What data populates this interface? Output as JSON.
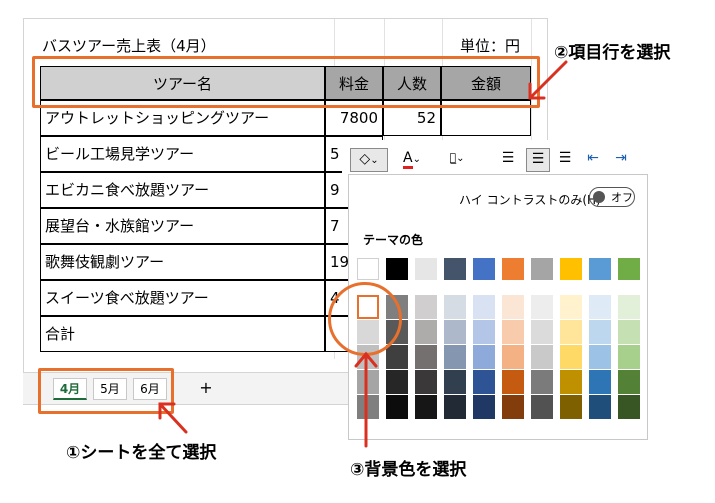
{
  "sheet": {
    "title": "バスツアー売上表（4月）",
    "unit": "単位：円",
    "headers": [
      "ツアー名",
      "料金",
      "人数",
      "金額"
    ],
    "rows": [
      {
        "name": "アウトレットショッピングツアー",
        "price": "7800",
        "people": "52"
      },
      {
        "name": "ビール工場見学ツアー",
        "price": "5",
        "people": ""
      },
      {
        "name": "エビカニ食べ放題ツアー",
        "price": "9",
        "people": ""
      },
      {
        "name": "展望台・水族館ツアー",
        "price": "7",
        "people": ""
      },
      {
        "name": "歌舞伎観劇ツアー",
        "price": "19",
        "people": ""
      },
      {
        "name": "スイーツ食べ放題ツアー",
        "price": "4",
        "people": ""
      },
      {
        "name": "合計",
        "price": "",
        "people": ""
      }
    ]
  },
  "tabs": [
    "4月",
    "5月",
    "6月"
  ],
  "add_sheet": "+",
  "palette": {
    "contrast_label": "ハイ コントラストのみ(H)",
    "toggle_label": "オフ",
    "theme_label": "テーマの色",
    "top_row": [
      "#ffffff",
      "#000000",
      "#e7e6e6",
      "#44546a",
      "#4472c4",
      "#ed7d31",
      "#a5a5a5",
      "#ffc000",
      "#5b9bd5",
      "#70ad47"
    ],
    "shades": [
      [
        "#f2f2f2",
        "#7f7f7f",
        "#d0cece",
        "#d6dce4",
        "#d9e2f3",
        "#fbe5d5",
        "#ededed",
        "#fff2cc",
        "#deebf6",
        "#e2efd9"
      ],
      [
        "#d8d8d8",
        "#595959",
        "#aeabab",
        "#adb9ca",
        "#b4c6e7",
        "#f7cbac",
        "#dbdbdb",
        "#fee599",
        "#bdd7ee",
        "#c5e0b3"
      ],
      [
        "#bfbfbf",
        "#3f3f3f",
        "#757070",
        "#8496b0",
        "#8eaadb",
        "#f4b183",
        "#c9c9c9",
        "#ffd966",
        "#9cc3e5",
        "#a8d08d"
      ],
      [
        "#a5a5a5",
        "#262626",
        "#3a3838",
        "#323f4f",
        "#2f5496",
        "#c55a11",
        "#7b7b7b",
        "#bf9000",
        "#2e75b5",
        "#538135"
      ],
      [
        "#7f7f7f",
        "#0c0c0c",
        "#171616",
        "#222a35",
        "#1f3864",
        "#833c0b",
        "#525252",
        "#7f6000",
        "#1e4e79",
        "#375623"
      ]
    ]
  },
  "annotations": {
    "step1": "①シートを全て選択",
    "step2": "②項目行を選択",
    "step3": "③背景色を選択"
  },
  "colors": {
    "accent": "#e7702d",
    "header_gray": "#d0d0d0",
    "header_dark": "#a6a6a6"
  }
}
